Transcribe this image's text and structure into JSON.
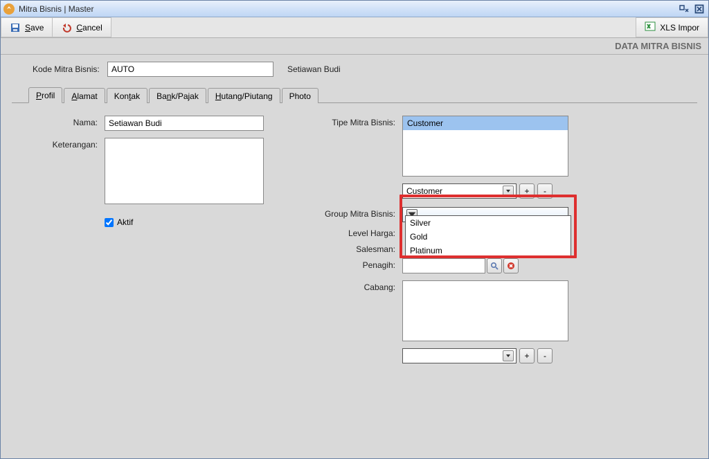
{
  "window": {
    "title": "Mitra Bisnis | Master"
  },
  "toolbar": {
    "save": "Save",
    "cancel": "Cancel",
    "xls": "XLS Impor"
  },
  "subheader": "DATA MITRA BISNIS",
  "kode": {
    "label": "Kode Mitra Bisnis:",
    "value": "AUTO",
    "display_name": "Setiawan Budi"
  },
  "tabs": {
    "profil": "Profil",
    "alamat": "Alamat",
    "kontak": "Kontak",
    "bank": "Bank/Pajak",
    "hutang": "Hutang/Piutang",
    "photo": "Photo"
  },
  "fields": {
    "nama_label": "Nama:",
    "nama_value": "Setiawan Budi",
    "keterangan_label": "Keterangan:",
    "keterangan_value": "",
    "aktif_label": "Aktif",
    "tipe_label": "Tipe Mitra Bisnis:",
    "tipe_list": [
      "Customer"
    ],
    "tipe_selected": "Customer",
    "tipe_combo_value": "Customer",
    "group_label": "Group Mitra Bisnis:",
    "group_options": [
      "Silver",
      "Gold",
      "Platinum"
    ],
    "group_value": "",
    "level_label": "Level Harga:",
    "salesman_label": "Salesman:",
    "penagih_label": "Penagih:",
    "penagih_value": "",
    "cabang_label": "Cabang:",
    "cabang_combo_value": "",
    "plus": "+",
    "minus": "-"
  }
}
